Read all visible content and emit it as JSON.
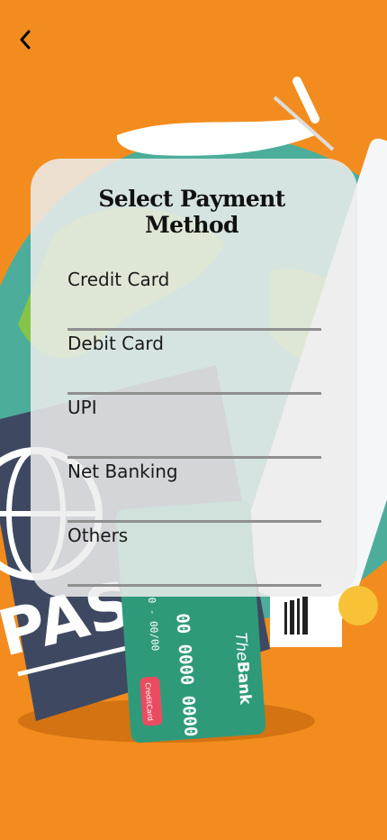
{
  "screen": {
    "title": "Select Payment Method",
    "back_icon": "chevron-left-icon"
  },
  "payment_methods": [
    {
      "label": "Credit Card"
    },
    {
      "label": "Debit Card"
    },
    {
      "label": "UPI"
    },
    {
      "label": "Net Banking"
    },
    {
      "label": "Others"
    }
  ],
  "colors": {
    "background": "#f28c1e",
    "card": "#ececec",
    "divider": "#8f8f8f",
    "passport": "#3e4961",
    "bank_card": "#2f9a7a",
    "globe": "#4cae9a"
  },
  "illustration": {
    "passport_text": "PASS",
    "bank_card_number": "00 0000 0000",
    "bank_card_expiry": "0 - 00/00",
    "bank_card_brand_prefix": "The",
    "bank_card_brand_suffix": "Bank",
    "bank_card_badge": "CreditCard"
  }
}
